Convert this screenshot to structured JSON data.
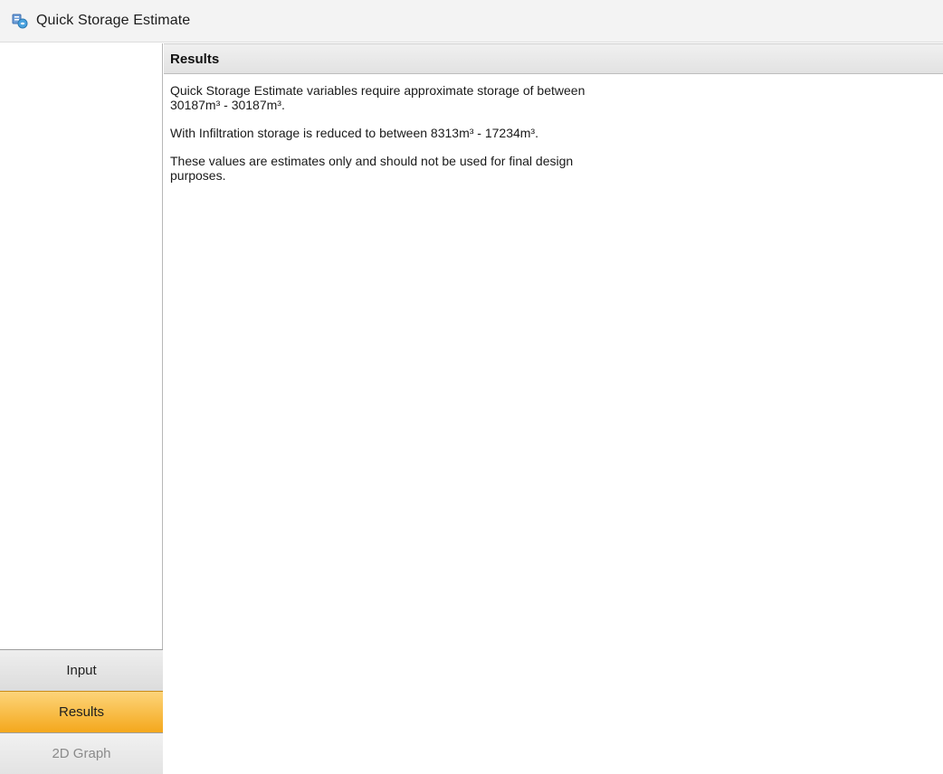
{
  "window": {
    "title": "Quick Storage Estimate",
    "app_icon": "storage-app-icon"
  },
  "results_panel": {
    "header": "Results",
    "paragraphs": [
      "Quick Storage Estimate variables require approximate storage of between 30187m³ - 30187m³.",
      "With Infiltration storage is reduced to between 8313m³ - 17234m³.",
      "These values are estimates only and should not be used for final design purposes."
    ]
  },
  "navigation": {
    "items": [
      {
        "label": "Input",
        "state": "normal"
      },
      {
        "label": "Results",
        "state": "selected"
      },
      {
        "label": "2D Graph",
        "state": "disabled"
      }
    ]
  },
  "colors": {
    "selected_nav": "#f4a81c",
    "header_bg": "#e2e2e2",
    "disabled_text": "#8a8a8a"
  }
}
